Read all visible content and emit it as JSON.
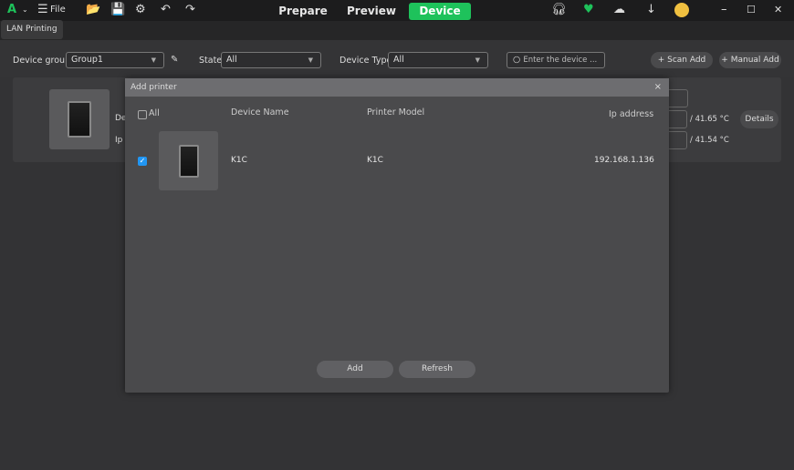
{
  "titlebar": {
    "file_label": "File",
    "tabs": [
      "Prepare",
      "Preview",
      "Device"
    ],
    "active_tab": "Device",
    "accent": "#1ec25b"
  },
  "tabstrip": {
    "tab": "LAN Printing"
  },
  "toolbar": {
    "group_label": "Device group:",
    "group_value": "Group1",
    "state_label": "State:",
    "state_value": "All",
    "type_label": "Device Type:",
    "type_value": "All",
    "search_placeholder": "Enter the device ...",
    "scan_add": "Scan Add",
    "manual_add": "Manual Add"
  },
  "card": {
    "temp1": "/ 41.65 °C",
    "temp2": "/ 41.54 °C",
    "details": "Details",
    "label_de": "De",
    "label_ip": "Ip"
  },
  "dialog": {
    "title": "Add printer",
    "all_label": "All",
    "headers": {
      "name": "Device Name",
      "model": "Printer Model",
      "ip": "Ip address"
    },
    "rows": [
      {
        "checked": true,
        "name": "K1C",
        "model": "K1C",
        "ip": "192.168.1.136"
      }
    ],
    "add": "Add",
    "refresh": "Refresh"
  }
}
